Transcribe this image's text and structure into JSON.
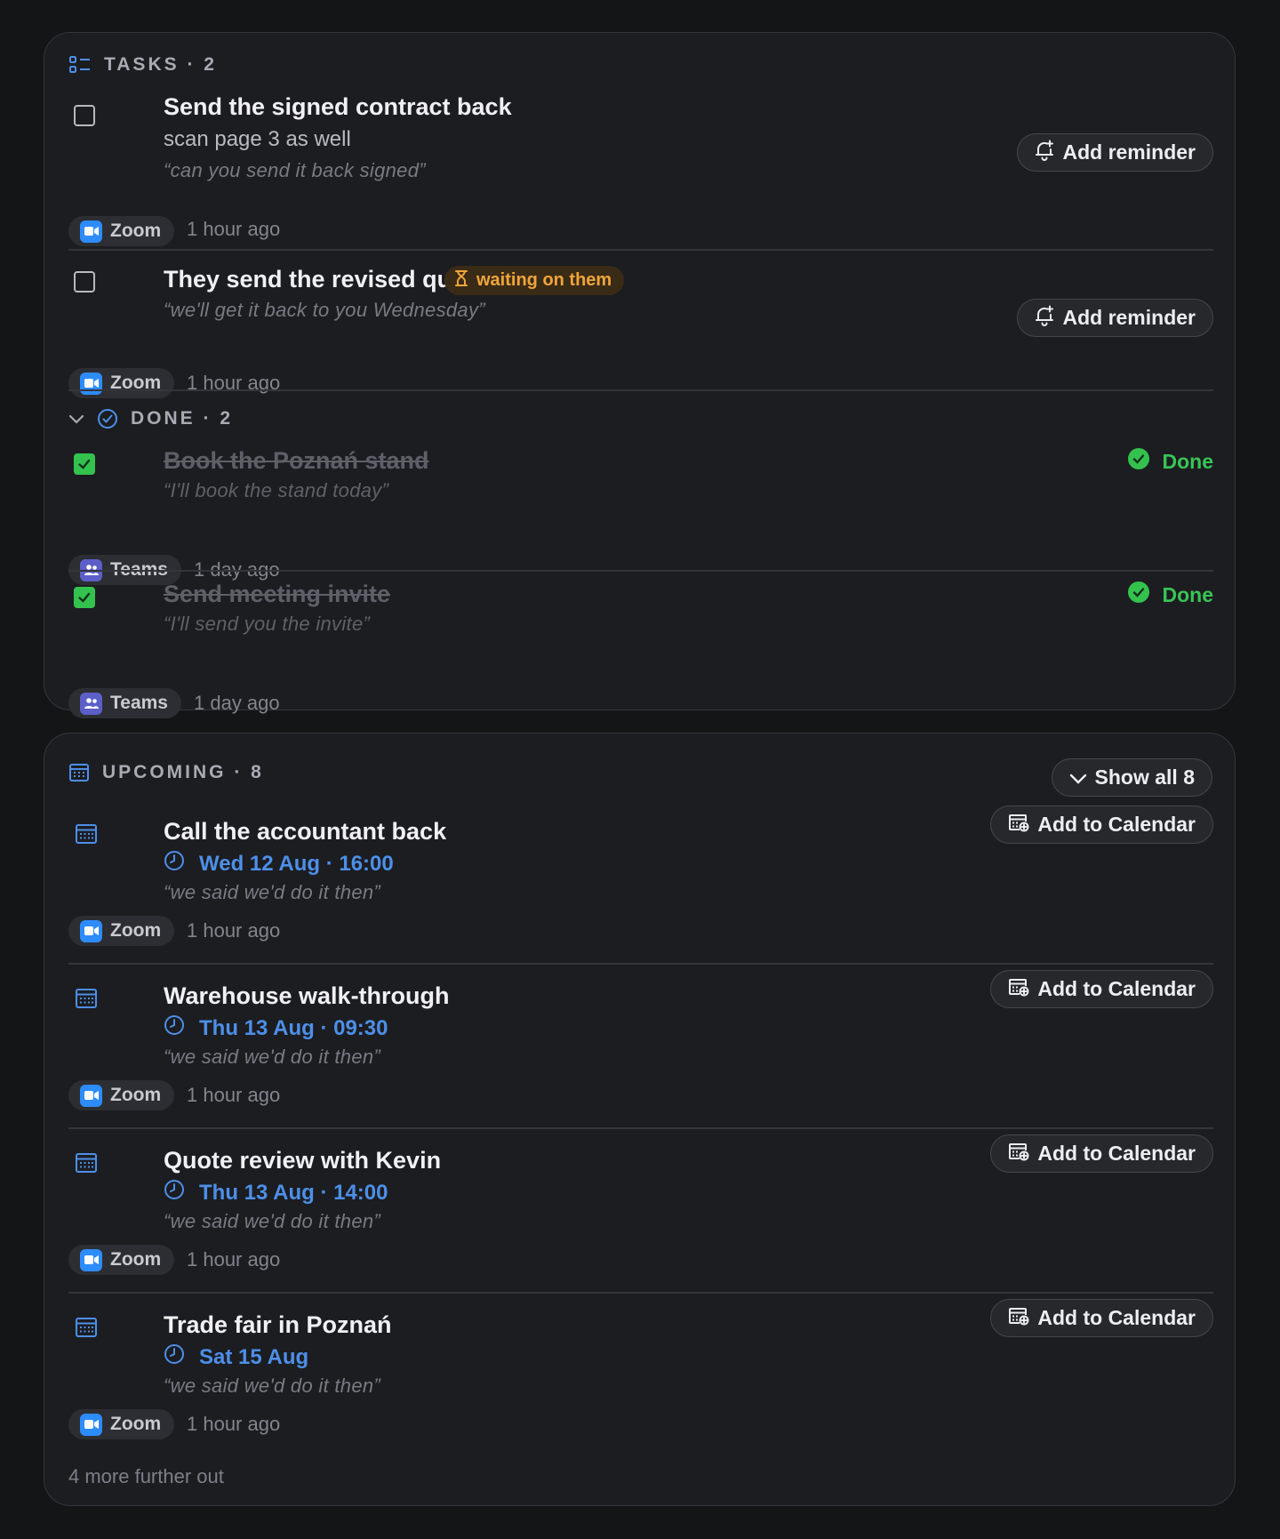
{
  "tasks_section": {
    "header": "TASKS · 2",
    "items": [
      {
        "title": "Send the signed contract back",
        "note": "scan page 3 as well",
        "quote": "“can you send it back signed”",
        "source": "Zoom",
        "time": "1 hour ago",
        "button": "Add reminder"
      },
      {
        "title": "They send the revised quote",
        "badge": "waiting on them",
        "quote": "“we'll get it back to you Wednesday”",
        "source": "Zoom",
        "time": "1 hour ago",
        "button": "Add reminder"
      }
    ]
  },
  "done_section": {
    "header": "DONE · 2",
    "items": [
      {
        "title": "Book the Poznań stand",
        "quote": "“I'll book the stand today”",
        "source": "Teams",
        "time": "1 day ago",
        "status": "Done"
      },
      {
        "title": "Send meeting invite",
        "quote": "“I'll send you the invite”",
        "source": "Teams",
        "time": "1 day ago",
        "status": "Done"
      }
    ]
  },
  "upcoming_section": {
    "header": "UPCOMING · 8",
    "show_all": "Show all 8",
    "items": [
      {
        "title": "Call the accountant back",
        "when": "Wed 12 Aug · 16:00",
        "quote": "“we said we'd do it then”",
        "source": "Zoom",
        "time": "1 hour ago",
        "button": "Add to Calendar"
      },
      {
        "title": "Warehouse walk-through",
        "when": "Thu 13 Aug · 09:30",
        "quote": "“we said we'd do it then”",
        "source": "Zoom",
        "time": "1 hour ago",
        "button": "Add to Calendar"
      },
      {
        "title": "Quote review with Kevin",
        "when": "Thu 13 Aug · 14:00",
        "quote": "“we said we'd do it then”",
        "source": "Zoom",
        "time": "1 hour ago",
        "button": "Add to Calendar"
      },
      {
        "title": "Trade fair in Poznań",
        "when": "Sat 15 Aug",
        "quote": "“we said we'd do it then”",
        "source": "Zoom",
        "time": "1 hour ago",
        "button": "Add to Calendar"
      }
    ],
    "footer": "4 more further out"
  },
  "icons": {
    "tasks_header": "list-check-icon",
    "done_header": "check-circle-icon",
    "upcoming_header": "calendar-icon",
    "reminder": "bell-plus-icon",
    "waiting": "hourglass-icon",
    "done_status": "check-circle-filled-icon",
    "time": "clock-icon",
    "add_calendar": "calendar-plus-icon",
    "zoom": "video-camera-icon",
    "teams": "people-icon"
  },
  "colors": {
    "accent_blue": "#4d8fe8",
    "done_green": "#38c455",
    "waiting_orange": "#f0a53a",
    "zoom_blue": "#2d8cff",
    "teams_purple": "#5b5fc7"
  }
}
